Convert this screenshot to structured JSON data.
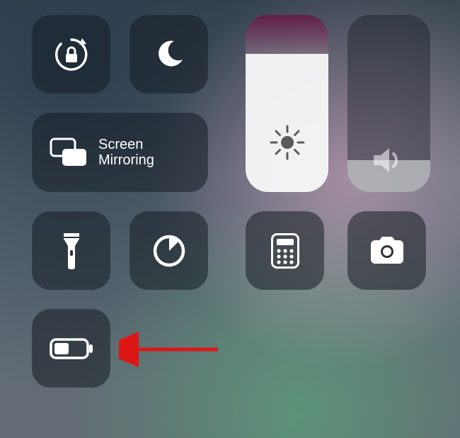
{
  "controls": {
    "rotation_lock": {
      "name": "rotation-lock-toggle"
    },
    "do_not_disturb": {
      "name": "do-not-disturb-toggle"
    },
    "screen_mirroring": {
      "label": "Screen\nMirroring"
    },
    "brightness": {
      "level_percent": 78
    },
    "volume": {
      "level_percent": 18
    },
    "flashlight": {
      "name": "flashlight-button"
    },
    "timer": {
      "name": "timer-button"
    },
    "calculator": {
      "name": "calculator-button"
    },
    "camera": {
      "name": "camera-button"
    },
    "low_power_mode": {
      "name": "low-power-mode-toggle"
    }
  },
  "annotation": {
    "target": "low-power-mode-toggle",
    "color": "#e11"
  }
}
